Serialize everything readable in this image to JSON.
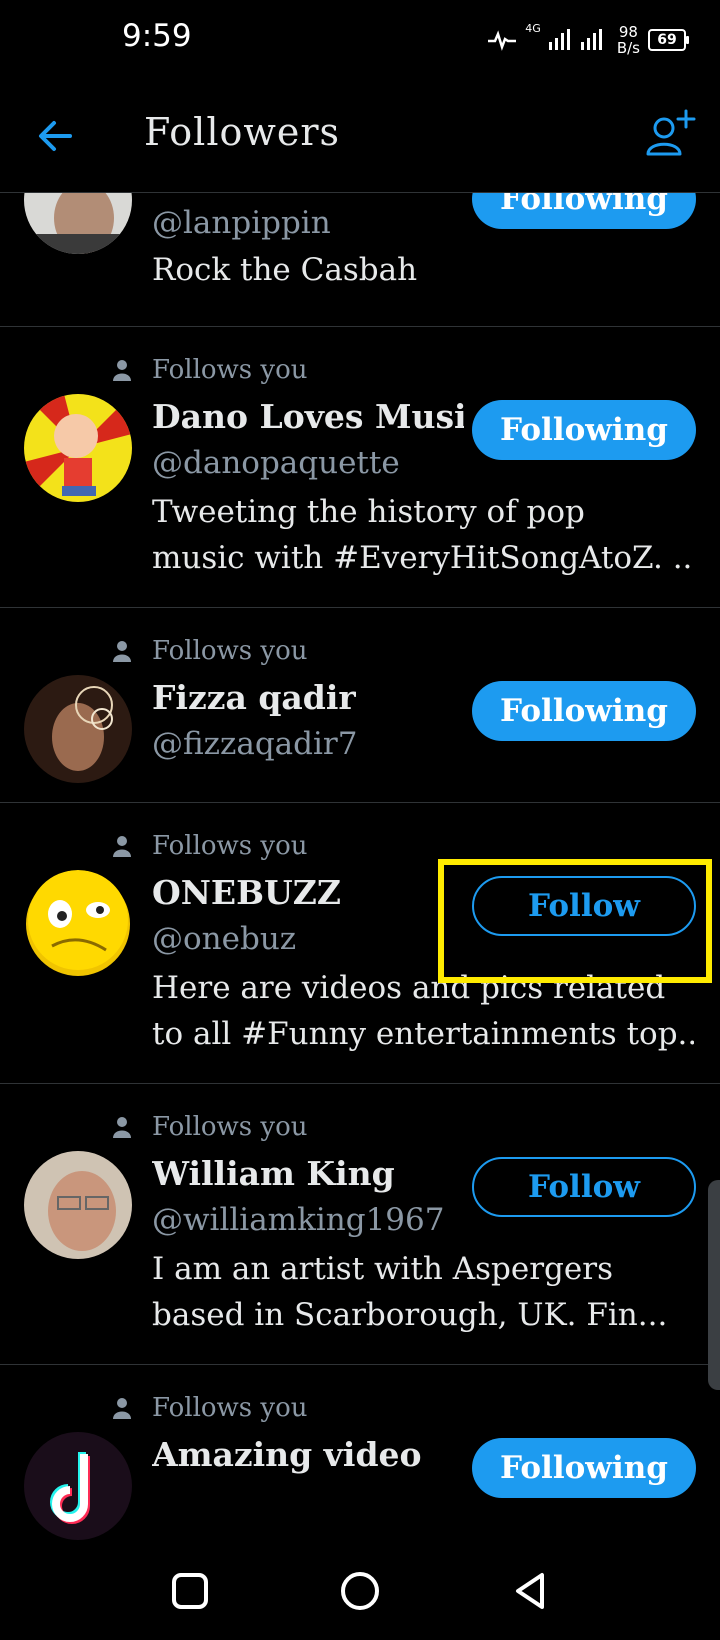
{
  "status_bar": {
    "time": "9:59",
    "network": "4G",
    "speed_value": "98",
    "speed_unit": "B/s",
    "battery": "69"
  },
  "header": {
    "title": "Followers",
    "back_icon": "arrow-left-icon",
    "add_icon": "add-person-icon"
  },
  "colors": {
    "accent": "#1d9bf0",
    "background": "#000000",
    "secondary_text": "#8b98a5",
    "highlight": "#ffeb00"
  },
  "followers": [
    {
      "follows_you": "",
      "name": "",
      "handle": "@lanpippin",
      "bio": [
        "Rock the Casbah"
      ],
      "button": "Following"
    },
    {
      "follows_you": "Follows you",
      "name": "Dano Loves Music...",
      "handle": "@danopaquette",
      "bio": [
        "Tweeting the history of pop",
        "music with #EveryHitSongAtoZ. ..."
      ],
      "button": "Following"
    },
    {
      "follows_you": "Follows you",
      "name": "Fizza qadir",
      "handle": "@fizzaqadir7",
      "bio": [],
      "button": "Following"
    },
    {
      "follows_you": "Follows you",
      "name": "ONEBUZZ",
      "handle": "@onebuz",
      "bio": [
        "Here are videos and pics related",
        "to all #Funny entertainments top..."
      ],
      "button": "Follow"
    },
    {
      "follows_you": "Follows you",
      "name": "William King",
      "handle": "@williamking1967",
      "bio": [
        "I am an artist with Aspergers",
        "based in Scarborough,  UK.  Fin..."
      ],
      "button": "Follow"
    },
    {
      "follows_you": "Follows you",
      "name": "Amazing video",
      "handle": "",
      "bio": [],
      "button": "Following"
    }
  ]
}
